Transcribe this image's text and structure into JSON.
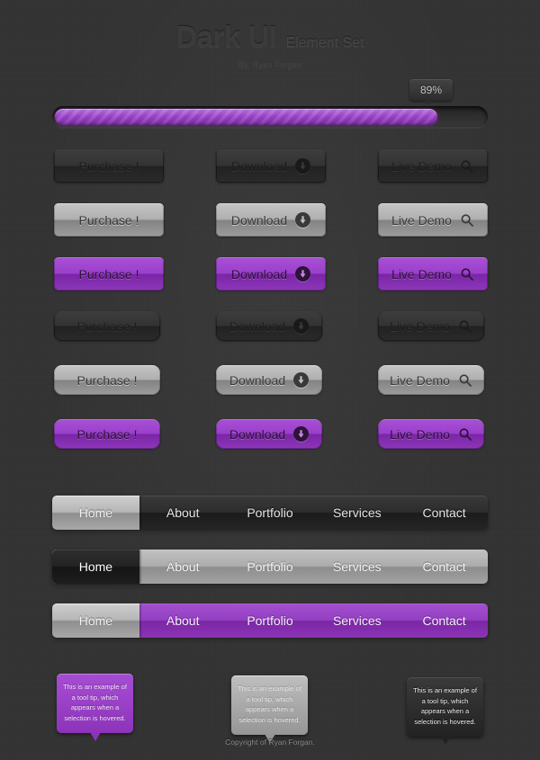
{
  "header": {
    "title_main": "Dark UI",
    "title_sub": "Element Set",
    "byline": "By, Ryan Forgan"
  },
  "progress": {
    "percent_label": "89%",
    "percent_value": 89,
    "accent_color": "#9437c4"
  },
  "buttons": {
    "labels": {
      "purchase": "Purchase !",
      "download": "Download",
      "live_demo": "Live Demo"
    },
    "icons": {
      "download": "download-circle-arrow-icon",
      "live_demo": "magnifier-search-icon"
    },
    "rows": [
      {
        "style": "dark",
        "size": "big"
      },
      {
        "style": "silver",
        "size": "big"
      },
      {
        "style": "purple",
        "size": "big"
      },
      {
        "style": "dark",
        "size": "small"
      },
      {
        "style": "silver",
        "size": "small"
      },
      {
        "style": "purple",
        "size": "small"
      }
    ]
  },
  "navs": [
    {
      "theme": "bar-dark",
      "active_style": "act-silver",
      "items": [
        "Home",
        "About",
        "Portfolio",
        "Services",
        "Contact"
      ]
    },
    {
      "theme": "bar-silver",
      "active_style": "act-dark",
      "items": [
        "Home",
        "About",
        "Portfolio",
        "Services",
        "Contact"
      ]
    },
    {
      "theme": "bar-purple",
      "active_style": "act-silver",
      "items": [
        "Home",
        "About",
        "Portfolio",
        "Services",
        "Contact"
      ]
    }
  ],
  "tooltips": {
    "text": "This is an example of a tool tip, which appears when a selection is hovered.",
    "variants": [
      "purple",
      "silver",
      "dark"
    ]
  },
  "footer": {
    "copyright": "Copyright of Ryan Forgan."
  },
  "palette": {
    "background": "#333233",
    "purple": "#9437c4",
    "silver": "#b0afb0",
    "dark": "#2b2a2b"
  }
}
